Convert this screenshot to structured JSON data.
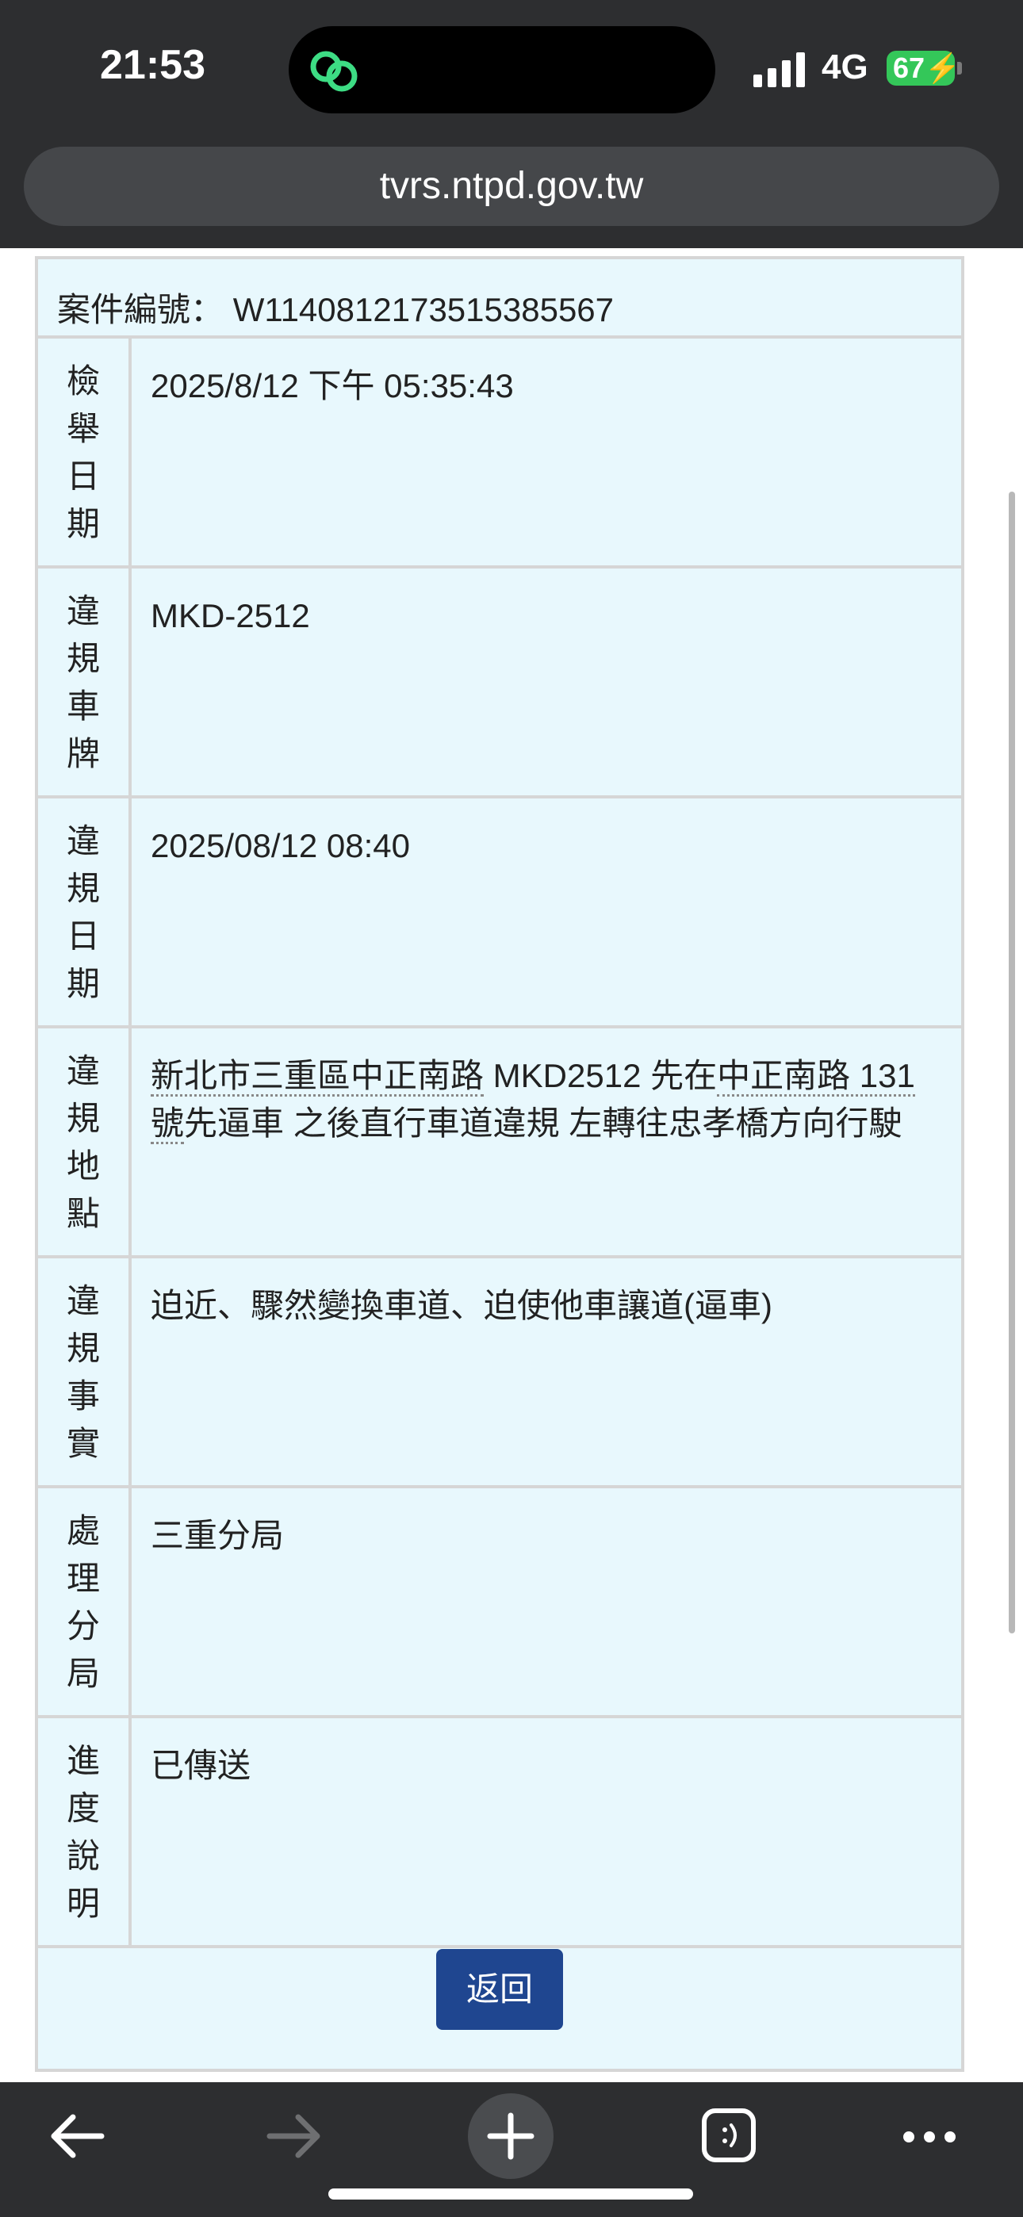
{
  "status_bar": {
    "time": "21:53",
    "network": "4G",
    "battery": "67"
  },
  "browser": {
    "url": "tvrs.ntpd.gov.tw"
  },
  "case": {
    "label": "案件編號：",
    "id": "W1140812173515385567"
  },
  "rows": [
    {
      "label": "檢舉日期",
      "value": "2025/8/12 下午 05:35:43"
    },
    {
      "label": "違規車牌",
      "value": "MKD-2512"
    },
    {
      "label": "違規日期",
      "value": "2025/08/12 08:40"
    },
    {
      "label": "違規地點",
      "value_parts": [
        "新北市三重區中正南路",
        " MKD2512 先在",
        "中正南路 131號",
        "先逼車 之後直行車道違規 左轉往忠孝橋方向行駛"
      ]
    },
    {
      "label": "違規事實",
      "value": "迫近、驟然變換車道、迫使他車讓道(逼車)"
    },
    {
      "label": "處理分局",
      "value": "三重分局"
    },
    {
      "label": "進度說明",
      "value": "已傳送"
    }
  ],
  "back_button": "返回",
  "icons": [
    "back-arrow-icon",
    "forward-arrow-icon",
    "plus-icon",
    "tabs-icon",
    "more-icon",
    "signal-icon",
    "link-icon"
  ]
}
